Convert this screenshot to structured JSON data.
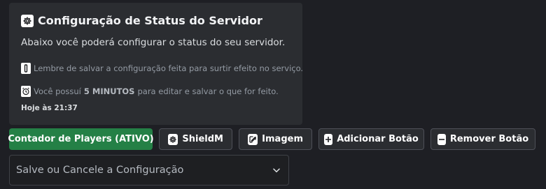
{
  "embed": {
    "title": "Configuração de Status do Servidor",
    "description": "Abaixo você poderá configurar o status do seu servidor.",
    "note1": "Lembre de salvar a configuração feita para surtir efeito no serviço.",
    "note2_prefix": "Você possuí",
    "note2_bold": "5 MINUTOS",
    "note2_suffix": "para editar e salvar o que for feito.",
    "timestamp": "Hoje às 21:37",
    "title_icon": "gear-icon",
    "note1_icon": "info-icon",
    "note2_icon": "alarm-clock-icon"
  },
  "buttons": [
    {
      "label": "Contador de Players (ATIVO)",
      "style": "success",
      "color": "#248046"
    },
    {
      "label": "ShieldM",
      "icon": "gear-icon"
    },
    {
      "label": "Imagem",
      "icon": "edit-icon"
    },
    {
      "label": "Adicionar Botão",
      "icon": "plus-icon"
    },
    {
      "label": "Remover Botão",
      "icon": "minus-icon"
    }
  ],
  "select": {
    "placeholder": "Salve ou Cancele a Configuração",
    "icon": "chevron-down-icon"
  }
}
